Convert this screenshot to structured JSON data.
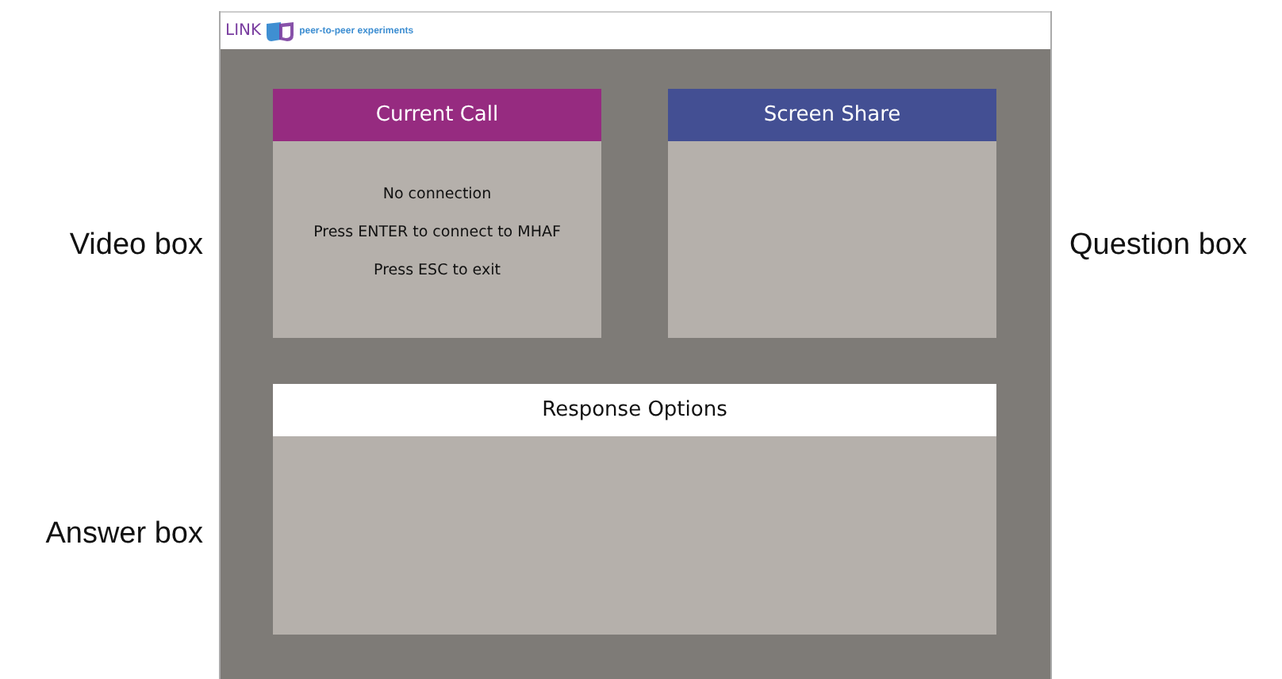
{
  "left_annotations": [
    "Video box",
    "Answer box"
  ],
  "right_annotations": [
    "Question box"
  ],
  "header": {
    "logo_text": "LINK",
    "tagline": "peer-to-peer experiments"
  },
  "panels": [
    {
      "title": "Current Call",
      "kind": "call",
      "color": "#962b80",
      "lines": [
        "No connection",
        "Press ENTER to connect to MHAF",
        "Press ESC to exit"
      ]
    },
    {
      "title": "Screen Share",
      "kind": "share",
      "color": "#434f93"
    },
    {
      "title": "Response Options",
      "kind": "response",
      "color": "#ffffff"
    }
  ]
}
